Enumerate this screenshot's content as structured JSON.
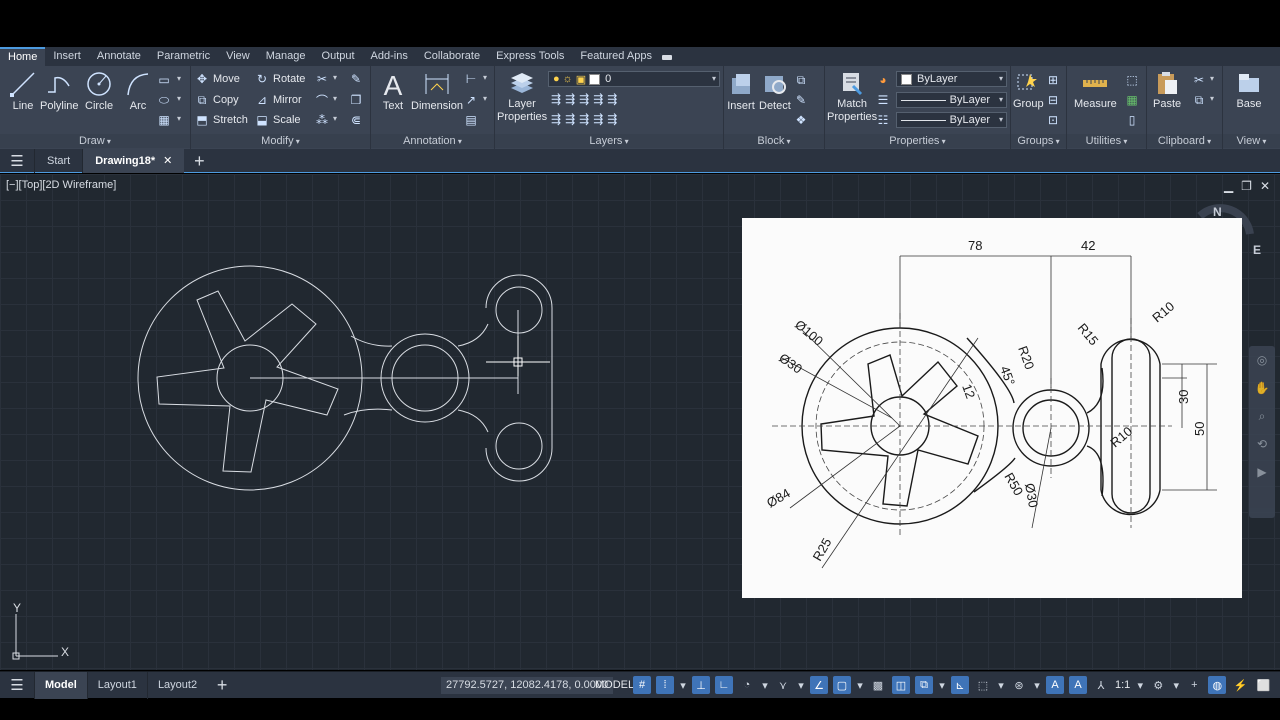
{
  "ribbon_tabs": [
    "Home",
    "Insert",
    "Annotate",
    "Parametric",
    "View",
    "Manage",
    "Output",
    "Add-ins",
    "Collaborate",
    "Express Tools",
    "Featured Apps"
  ],
  "active_tab": "Home",
  "draw_panel": {
    "title": "Draw",
    "line": "Line",
    "polyline": "Polyline",
    "circle": "Circle",
    "arc": "Arc"
  },
  "modify_panel": {
    "title": "Modify",
    "move": "Move",
    "rotate": "Rotate",
    "copy": "Copy",
    "mirror": "Mirror",
    "stretch": "Stretch",
    "scale": "Scale"
  },
  "annotation_panel": {
    "title": "Annotation",
    "text": "Text",
    "dimension": "Dimension"
  },
  "layers_panel": {
    "title": "Layers",
    "layer_properties_1": "Layer",
    "layer_properties_2": "Properties",
    "current_layer": "0"
  },
  "block_panel": {
    "title": "Block",
    "insert": "Insert",
    "detect": "Detect"
  },
  "properties_panel": {
    "title": "Properties",
    "match_1": "Match",
    "match_2": "Properties",
    "color": "ByLayer",
    "linetype": "ByLayer",
    "lineweight": "ByLayer"
  },
  "groups_panel": {
    "title": "Groups",
    "group": "Group"
  },
  "utilities_panel": {
    "title": "Utilities",
    "measure": "Measure"
  },
  "clipboard_panel": {
    "title": "Clipboard",
    "paste": "Paste"
  },
  "view_panel": {
    "title": "View",
    "base": "Base"
  },
  "file_tabs": {
    "start": "Start",
    "drawing": "Drawing18*",
    "close": "✕",
    "add": "+"
  },
  "viewport": {
    "label": "[−][Top][2D Wireframe]",
    "compass_n": "N",
    "compass_e": "E",
    "ucs_y": "Y",
    "ucs_x": "X"
  },
  "reference_drawing": {
    "dims": {
      "d78": "78",
      "d42": "42",
      "r15": "R15",
      "r10_top": "R10",
      "dia100": "Ø100",
      "dia30": "Ø30",
      "r20": "R20",
      "ang45": "45°",
      "d12": "12",
      "d30": "30",
      "d50": "50",
      "r10_mid": "R10",
      "r50": "R50",
      "dia30b": "Ø30",
      "dia84": "Ø84",
      "r25": "R25"
    }
  },
  "status_bar": {
    "model_tab": "Model",
    "layout1": "Layout1",
    "layout2": "Layout2",
    "add": "+",
    "coords": "27792.5727, 12082.4178, 0.0000",
    "mode": "MODEL",
    "scale": "1:1"
  },
  "colors": {
    "accent": "#4d9be0",
    "canvas": "#212830",
    "ribbon": "#3b4453"
  }
}
